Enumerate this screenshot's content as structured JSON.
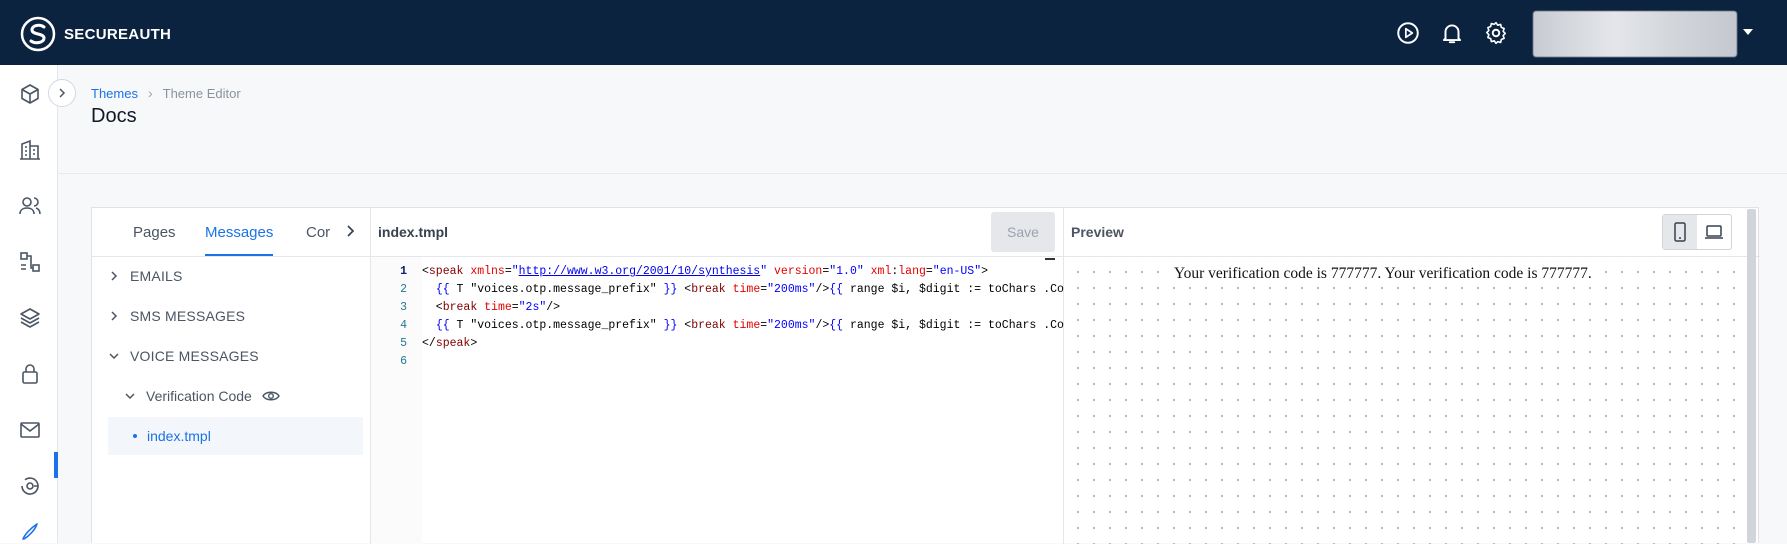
{
  "app": {
    "brand": "SECUREAUTH"
  },
  "header": {
    "icons": [
      "play-circle-icon",
      "bell-icon",
      "gear-icon"
    ],
    "user_menu": {
      "caret": "chevron-down-icon"
    }
  },
  "sidenav": {
    "items": [
      "cube-icon",
      "building-icon",
      "users-icon",
      "workflow-icon",
      "layers-icon",
      "lock-icon",
      "mail-icon",
      "radar-icon",
      "brush-icon"
    ]
  },
  "breadcrumb": {
    "link": "Themes",
    "current": "Theme Editor"
  },
  "page": {
    "title": "Docs"
  },
  "tabs": [
    {
      "label": "Pages",
      "active": false
    },
    {
      "label": "Messages",
      "active": true
    },
    {
      "label": "Cor",
      "active": false
    }
  ],
  "tree": {
    "emails": "EMAILS",
    "sms": "SMS MESSAGES",
    "voice": "VOICE MESSAGES",
    "verification": "Verification Code",
    "file": "index.tmpl"
  },
  "editor": {
    "filename": "index.tmpl",
    "save_label": "Save",
    "line_numbers": [
      "1",
      "2",
      "3",
      "4",
      "5",
      "6"
    ]
  },
  "preview": {
    "title": "Preview",
    "text": "Your verification code is 777777. Your verification code is 777777.",
    "device_active": "mobile"
  },
  "colors": {
    "topbar": "#0c2340",
    "accent": "#1a73e8"
  }
}
